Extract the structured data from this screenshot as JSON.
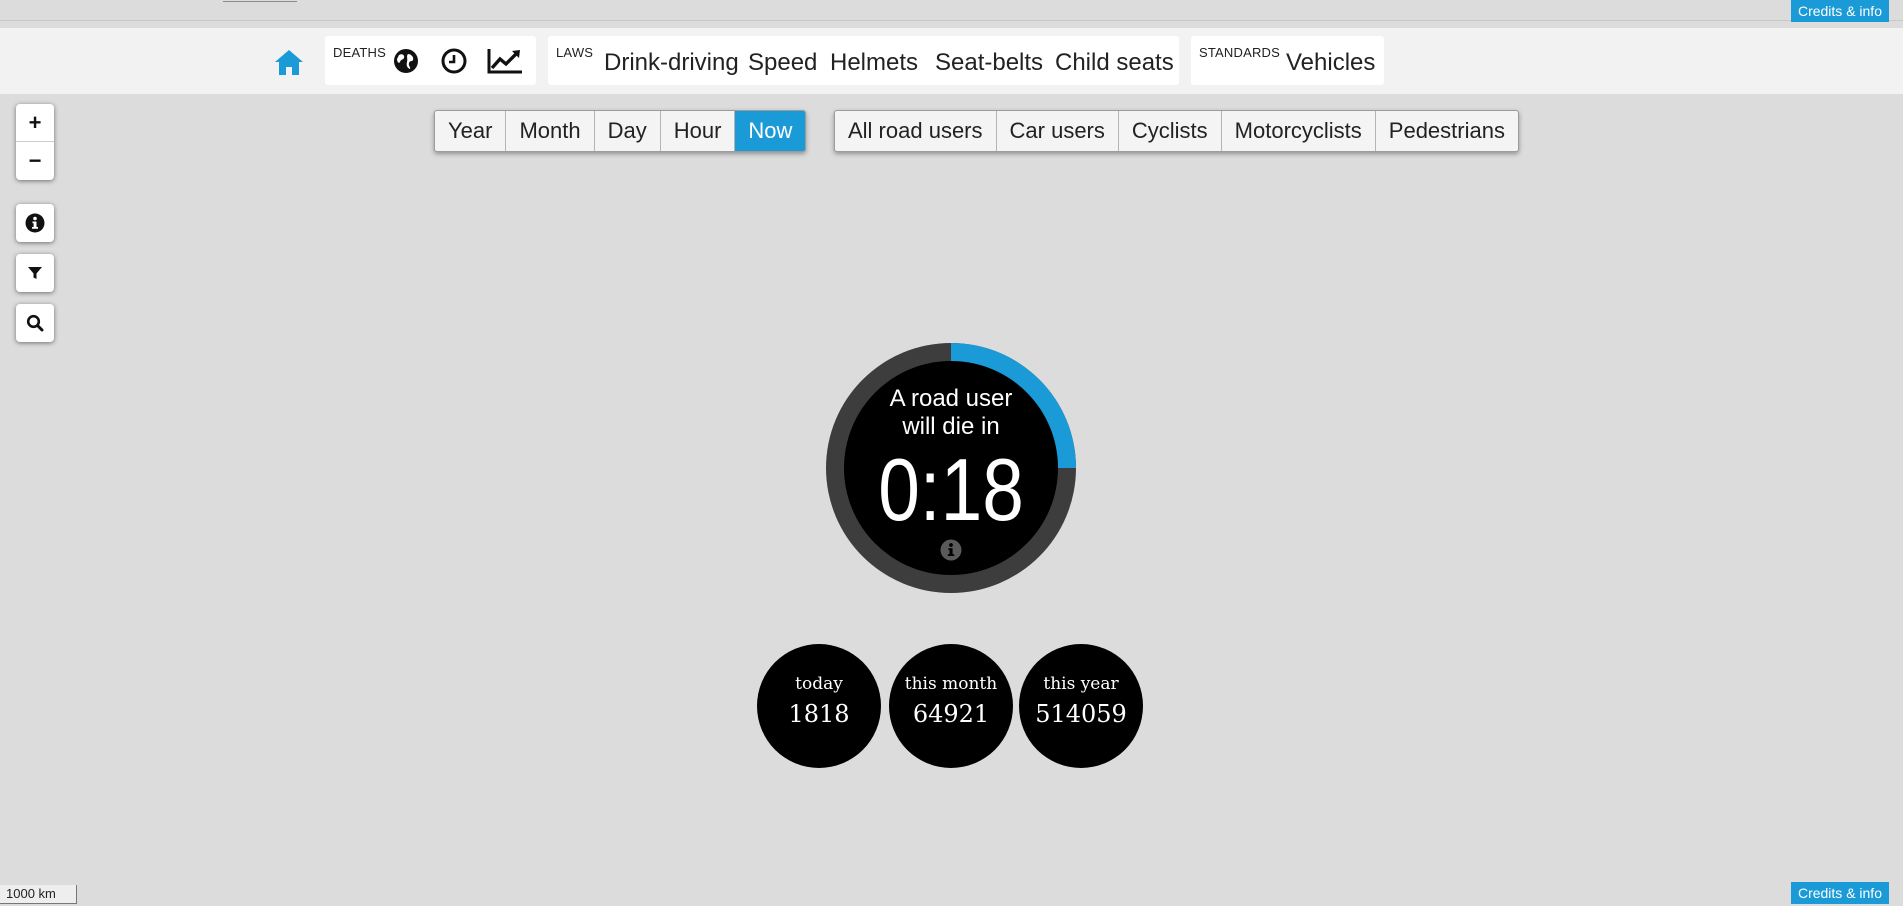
{
  "credits_label": "Credits & info",
  "nav": {
    "home_icon": "home-icon",
    "deaths_caption": "DEATHS",
    "deaths_icons": [
      "globe-icon",
      "clock-icon",
      "chart-line-icon"
    ],
    "laws_caption": "LAWS",
    "laws_items": [
      "Drink-driving",
      "Speed",
      "Helmets",
      "Seat-belts",
      "Child seats"
    ],
    "standards_caption": "STANDARDS",
    "standards_items": [
      "Vehicles"
    ]
  },
  "time_filter": {
    "options": [
      "Year",
      "Month",
      "Day",
      "Hour",
      "Now"
    ],
    "selected": "Now"
  },
  "user_filter": {
    "options": [
      "All road users",
      "Car users",
      "Cyclists",
      "Motorcyclists",
      "Pedestrians"
    ]
  },
  "map_controls": {
    "zoom_in": "+",
    "zoom_out": "−",
    "icons": [
      "info-icon",
      "filter-icon",
      "search-icon"
    ]
  },
  "timer": {
    "line1": "A road user",
    "line2": "will die in",
    "countdown": "0:18",
    "progress_fraction": 0.25
  },
  "stats": [
    {
      "label": "today",
      "value": "1818"
    },
    {
      "label": "this month",
      "value": "64921"
    },
    {
      "label": "this year",
      "value": "514059"
    }
  ],
  "scale_label": "1000 km",
  "colors": {
    "accent": "#1a9ad6",
    "dial_ring": "#3d3d3d",
    "dial_face": "#000000",
    "background": "#dcdcdc"
  }
}
